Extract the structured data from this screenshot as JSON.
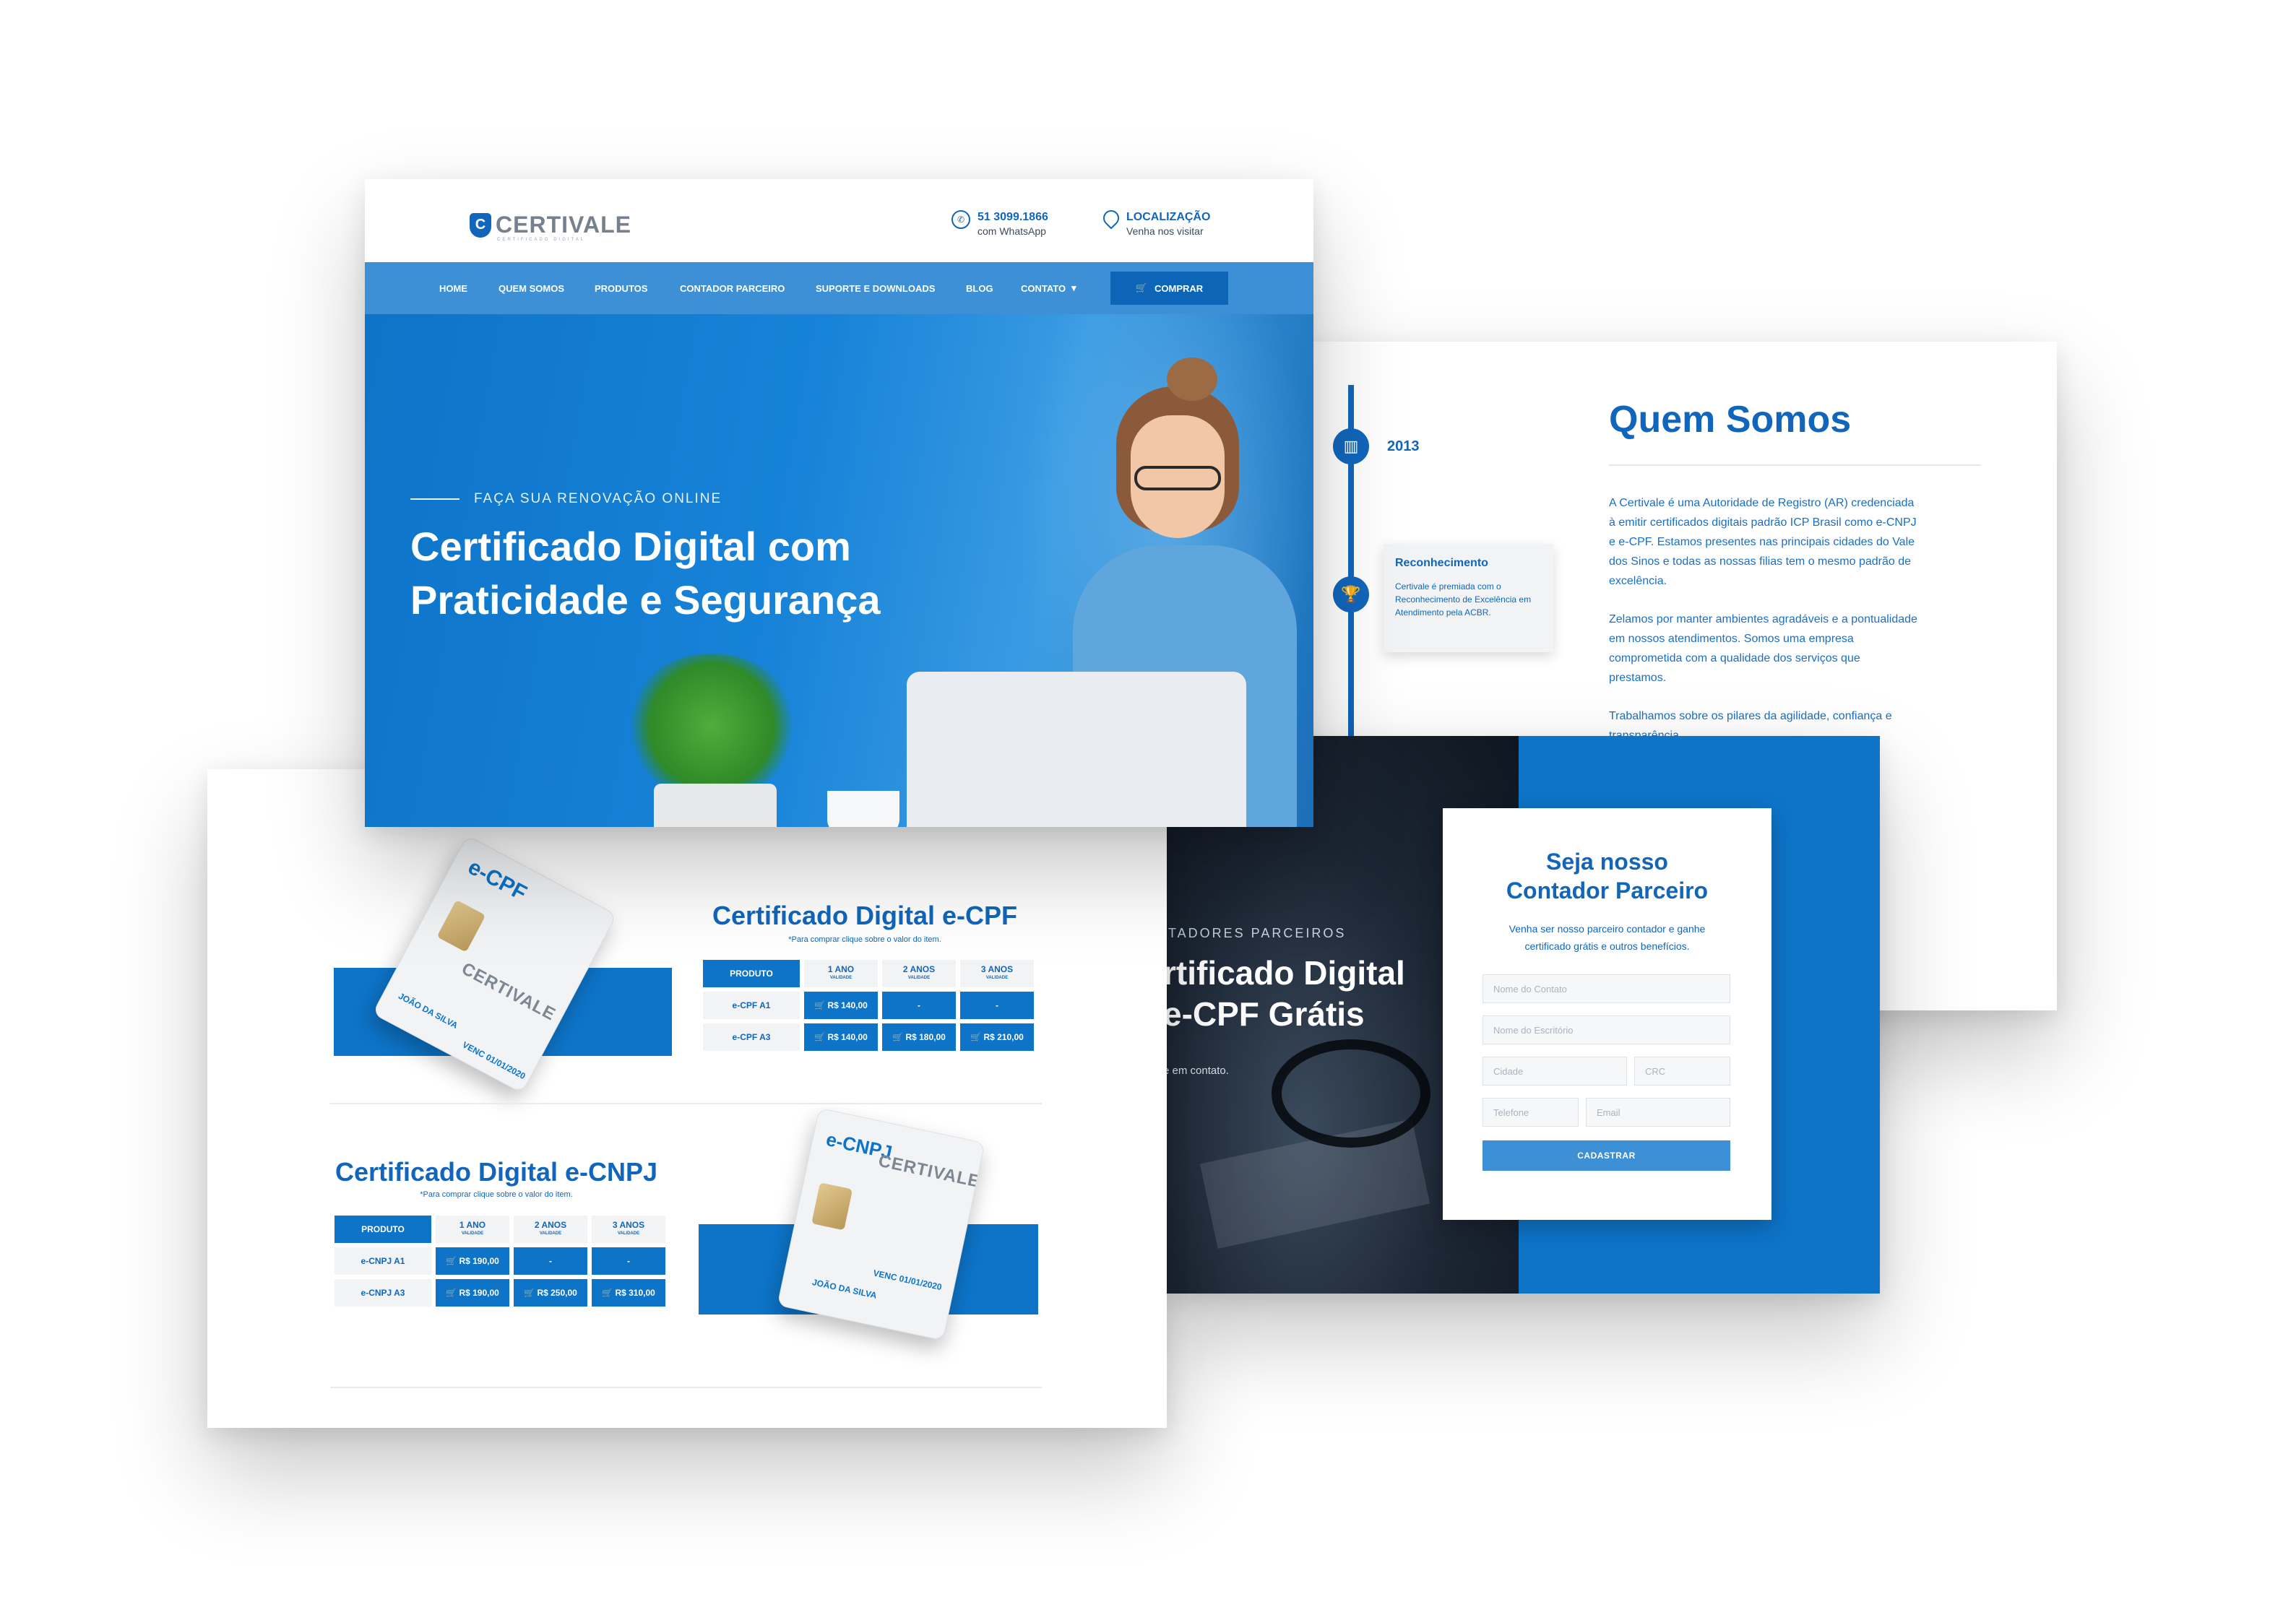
{
  "brand": {
    "name": "CERTIVALE",
    "tagline": "CERTIFICADO DIGITAL",
    "logo_mark": "C"
  },
  "header": {
    "phone": "51 3099.1866",
    "phone_sub": "com WhatsApp",
    "location": "LOCALIZAÇÃO",
    "location_sub": "Venha nos visitar"
  },
  "nav": {
    "items": [
      "HOME",
      "QUEM SOMOS",
      "PRODUTOS",
      "CONTADOR PARCEIRO",
      "SUPORTE E DOWNLOADS",
      "BLOG",
      "CONTATO"
    ],
    "contact_caret": "▾",
    "buy_label": "COMPRAR"
  },
  "hero": {
    "eyebrow": "FAÇA SUA RENOVAÇÃO ONLINE",
    "title_line1": "Certificado Digital com",
    "title_line2": "Praticidade e Segurança"
  },
  "about": {
    "title": "Quem Somos",
    "timeline": [
      {
        "year": "2013",
        "icon": "building-icon"
      },
      {
        "card_title": "Reconhecimento",
        "card_text": "Certivale é premiada com o Reconhecimento de Excelência em Atendimento pela ACBR.",
        "icon": "trophy-icon"
      }
    ],
    "paragraphs": [
      "A Certivale é uma Autoridade de Registro (AR) credenciada à emitir certificados digitais padrão ICP Brasil como e-CNPJ e e-CPF. Estamos presentes nas principais cidades do Vale dos Sinos e todas as nossas filias tem o mesmo padrão de excelência.",
      "Zelamos por manter ambientes agradáveis e a pontualidade em nossos atendimentos. Somos uma empresa comprometida com a qualidade dos serviços que prestamos.",
      "Trabalhamos sobre os pilares da agilidade, confiança e transparência."
    ]
  },
  "partner": {
    "eyebrow": "CONTADORES PARCEIROS",
    "title_line1": "rtificado Digital",
    "title_line2": "e-CPF Grátis",
    "sub": "e em contato.",
    "form_title_line1": "Seja nosso",
    "form_title_line2": "Contador Parceiro",
    "form_desc": "Venha ser nosso parceiro contador e ganhe certificado grátis e outros benefícios.",
    "placeholders": {
      "contact": "Nome do Contato",
      "office": "Nome do Escritório",
      "city": "Cidade",
      "crc": "CRC",
      "phone": "Telefone",
      "email": "Email"
    },
    "submit": "CADASTRAR"
  },
  "products": {
    "cpf": {
      "title": "Certificado Digital e-CPF",
      "note": "*Para comprar clique sobre o valor do item.",
      "card_logo": "e-CPF",
      "card_brand": "CERTIVALE",
      "card_holder": "JOÃO DA SILVA",
      "card_venc": "VENC 01/01/2020",
      "head": {
        "product": "PRODUTO",
        "c1": "1 ANO",
        "c2": "2 ANOS",
        "c3": "3 ANOS",
        "sub": "VALIDADE"
      },
      "rows": [
        {
          "name": "e-CPF A1",
          "p1": "R$ 140,00",
          "p2": "-",
          "p3": "-"
        },
        {
          "name": "e-CPF A3",
          "p1": "R$ 140,00",
          "p2": "R$ 180,00",
          "p3": "R$ 210,00"
        }
      ]
    },
    "cnpj": {
      "title": "Certificado Digital e-CNPJ",
      "note": "*Para comprar clique sobre o valor do item.",
      "card_logo": "e-CNPJ",
      "card_brand": "CERTIVALE",
      "card_holder": "JOÃO DA SILVA",
      "card_venc": "VENC 01/01/2020",
      "head": {
        "product": "PRODUTO",
        "c1": "1 ANO",
        "c2": "2 ANOS",
        "c3": "3 ANOS",
        "sub": "VALIDADE"
      },
      "rows": [
        {
          "name": "e-CNPJ A1",
          "p1": "R$ 190,00",
          "p2": "-",
          "p3": "-"
        },
        {
          "name": "e-CNPJ A3",
          "p1": "R$ 190,00",
          "p2": "R$ 250,00",
          "p3": "R$ 310,00"
        }
      ]
    }
  },
  "colors": {
    "primary": "#0d74c8",
    "nav": "#3d8fd6",
    "text_blue": "#1166bb"
  }
}
